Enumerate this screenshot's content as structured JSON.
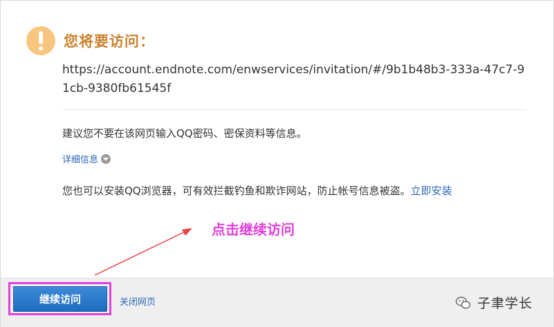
{
  "dialog": {
    "title": "您将要访问：",
    "url": "https://account.endnote.com/enwservices/invitation/#/9b1b48b3-333a-47c7-91cb-9380fb61545f",
    "advice": "建议您不要在该网页输入QQ密码、密保资料等信息。",
    "details_label": "详细信息",
    "promo_text": "您也可以安装QQ浏览器，可有效拦截钓鱼和欺诈网站，防止帐号信息被盗。",
    "promo_link": "立即安装"
  },
  "annotation": {
    "text": "点击继续访问",
    "color": "#e040d8"
  },
  "footer": {
    "continue_label": "继续访问",
    "close_label": "关闭网页"
  },
  "watermark": {
    "text": "子聿学长",
    "icon": "wechat-icon"
  },
  "colors": {
    "title": "#c9822e",
    "link": "#2b66b8",
    "button": "#2a7ad0",
    "warning_icon": "#f7c780"
  }
}
